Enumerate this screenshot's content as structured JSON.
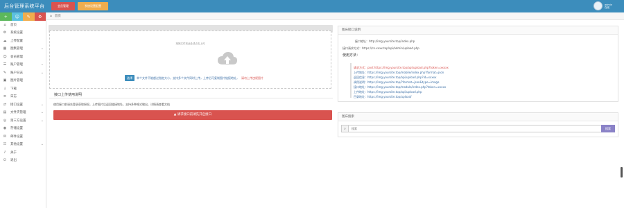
{
  "app": {
    "brand": "后台管理系统平台",
    "top_buttons": [
      "会员管理",
      "系统设置配置"
    ]
  },
  "user": {
    "name": "admin",
    "status": "在线"
  },
  "sidebar": {
    "tool_icons": [
      "plus-icon",
      "user-icon",
      "pencil-icon",
      "gear-icon"
    ],
    "items": [
      {
        "label": "首页",
        "icon": "⌂",
        "chevron": false
      },
      {
        "label": "系统设置",
        "icon": "⚙",
        "chevron": false
      },
      {
        "label": "上传配置",
        "icon": "☁",
        "chevron": false
      },
      {
        "label": "图集管理",
        "icon": "▦",
        "chevron": true
      },
      {
        "label": "会员管理",
        "icon": "☺",
        "chevron": false
      },
      {
        "label": "账户管理",
        "icon": "☰",
        "chevron": true
      },
      {
        "label": "账户日志",
        "icon": "✎",
        "chevron": true
      },
      {
        "label": "图片管理",
        "icon": "▣",
        "chevron": false
      },
      {
        "label": "下载",
        "icon": "↓",
        "chevron": false
      },
      {
        "label": "日志",
        "icon": "≡",
        "chevron": false
      },
      {
        "label": "接口设置",
        "icon": "⇄",
        "chevron": true
      },
      {
        "label": "文件夹管理",
        "icon": "▤",
        "chevron": true
      },
      {
        "label": "第三方设置",
        "icon": "◎",
        "chevron": true
      },
      {
        "label": "存储设置",
        "icon": "◉",
        "chevron": false
      },
      {
        "label": "邮件设置",
        "icon": "✉",
        "chevron": false
      },
      {
        "label": "其他设置",
        "icon": "☷",
        "chevron": true
      },
      {
        "label": "关于",
        "icon": "♪",
        "chevron": false
      },
      {
        "label": "退出",
        "icon": "⏻",
        "chevron": false
      }
    ]
  },
  "breadcrumb": {
    "home": "首页"
  },
  "upload": {
    "hint": "拖拽文件到此处或点击上传",
    "select_label": "选择",
    "help": "单个文件不能超过指定大小，支持多个文件同时上传，上传后可复制图片链接地址，",
    "help_red": "请勿上传违规图片"
  },
  "left_section": {
    "title": "接口上传使用说明",
    "paragraph": "使用接口前请先登录获取授权，上传图片后返回链接地址，支持多种格式输出，详情请查看文档",
    "danger_label": "▲ 请求接口前请先开启接口"
  },
  "right_panel": {
    "title": "图床接口说明",
    "lines": [
      "接口地址：http://img.yoursite.top/index.php",
      "接口请求方式：https://cn.xxxx.top/api/admin/upload.php"
    ],
    "usage_title": "使用方法：",
    "usage_lines": [
      "请求方式：post     https://img.yoursite.top/api/upload.php?token=xxxxx",
      "上传地址：https://img.yoursite.top/mobile/index.php?format=json",
      "返回信息：https://img.yoursite.top/api/upload.php?id=xxxxx",
      "调用说明：https://img.yoursite.top/?format=json&type=image",
      "接口地址：https://img.yoursite.top/module/index.php?token=xxxxx",
      "上传地址：https://img.yoursite.top/api/upload.php",
      "目录地址：https://img.yoursite.top/upload/"
    ]
  },
  "search_panel": {
    "title": "图床搜索",
    "placeholder": "搜索",
    "button": "搜索"
  }
}
